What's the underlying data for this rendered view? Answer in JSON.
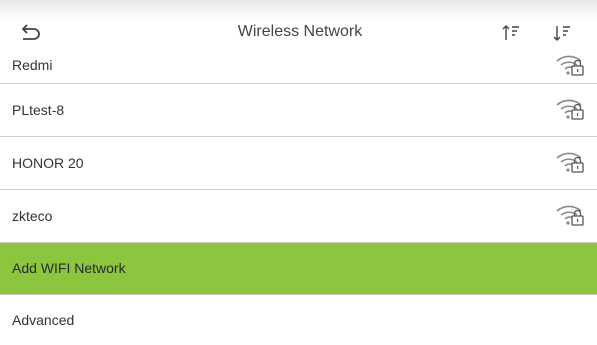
{
  "header": {
    "title": "Wireless Network",
    "back_icon": "back-arrow-icon",
    "sort_ascending_icon": "sort-ascending-icon",
    "sort_descending_icon": "sort-descending-icon"
  },
  "networks": [
    {
      "ssid": "Redmi",
      "secured": true,
      "icon": "wifi-lock-icon"
    },
    {
      "ssid": "PLtest-8",
      "secured": true,
      "icon": "wifi-lock-icon"
    },
    {
      "ssid": "HONOR 20",
      "secured": true,
      "icon": "wifi-lock-icon"
    },
    {
      "ssid": "zkteco",
      "secured": true,
      "icon": "wifi-lock-icon"
    }
  ],
  "actions": {
    "add_network_label": "Add WIFI Network",
    "advanced_label": "Advanced"
  },
  "colors": {
    "highlight": "#8cc63e",
    "icon": "#8a8a8a",
    "divider": "#d0d0d0"
  }
}
